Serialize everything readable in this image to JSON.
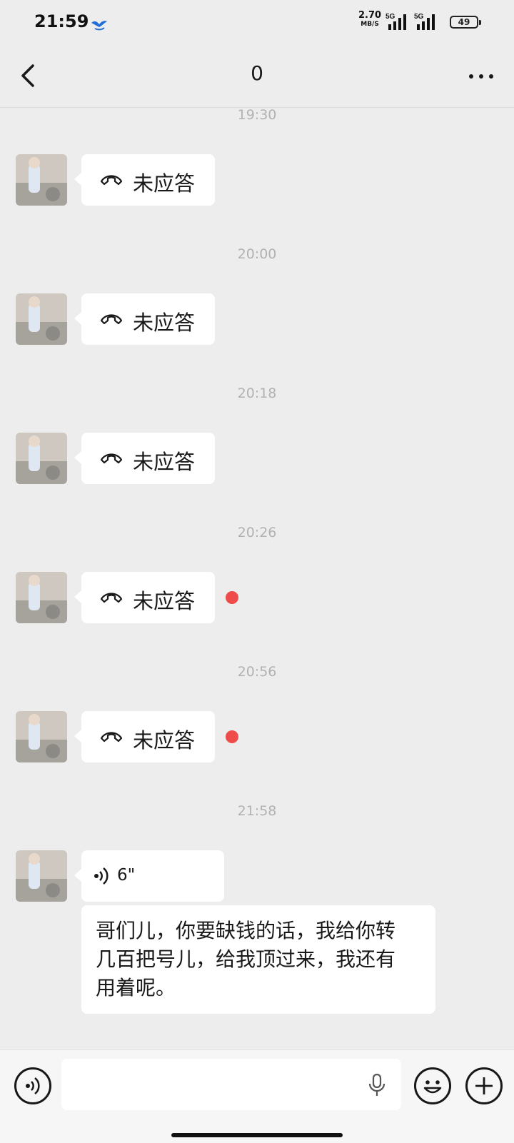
{
  "status_bar": {
    "time": "21:59",
    "net_speed": "2.70",
    "net_unit": "MB/S",
    "signal1": "5G",
    "signal2": "5G",
    "battery": "49"
  },
  "nav": {
    "title": "0"
  },
  "messages": [
    {
      "type": "timestamp",
      "text": "19:30"
    },
    {
      "type": "call",
      "label": "未应答",
      "unread": false
    },
    {
      "type": "timestamp",
      "text": "20:00"
    },
    {
      "type": "call",
      "label": "未应答",
      "unread": false
    },
    {
      "type": "timestamp",
      "text": "20:18"
    },
    {
      "type": "call",
      "label": "未应答",
      "unread": false
    },
    {
      "type": "timestamp",
      "text": "20:26"
    },
    {
      "type": "call",
      "label": "未应答",
      "unread": true
    },
    {
      "type": "timestamp",
      "text": "20:56"
    },
    {
      "type": "call",
      "label": "未应答",
      "unread": true
    },
    {
      "type": "timestamp",
      "text": "21:58"
    },
    {
      "type": "voice",
      "duration": "6\""
    },
    {
      "type": "text",
      "lines": [
        "哥们儿，你要缺钱的话，我给你转",
        "几百把号儿，给我顶过来，我还有",
        "用着呢。"
      ]
    }
  ],
  "colors": {
    "background": "#ededed",
    "bubble": "#ffffff",
    "unread_dot": "#f04b4b",
    "timestamp": "#b2b2b2"
  },
  "icons": [
    "back-arrow-icon",
    "more-dots-icon",
    "missed-call-icon",
    "voice-wave-icon",
    "microphone-icon",
    "emoji-icon",
    "plus-icon"
  ]
}
